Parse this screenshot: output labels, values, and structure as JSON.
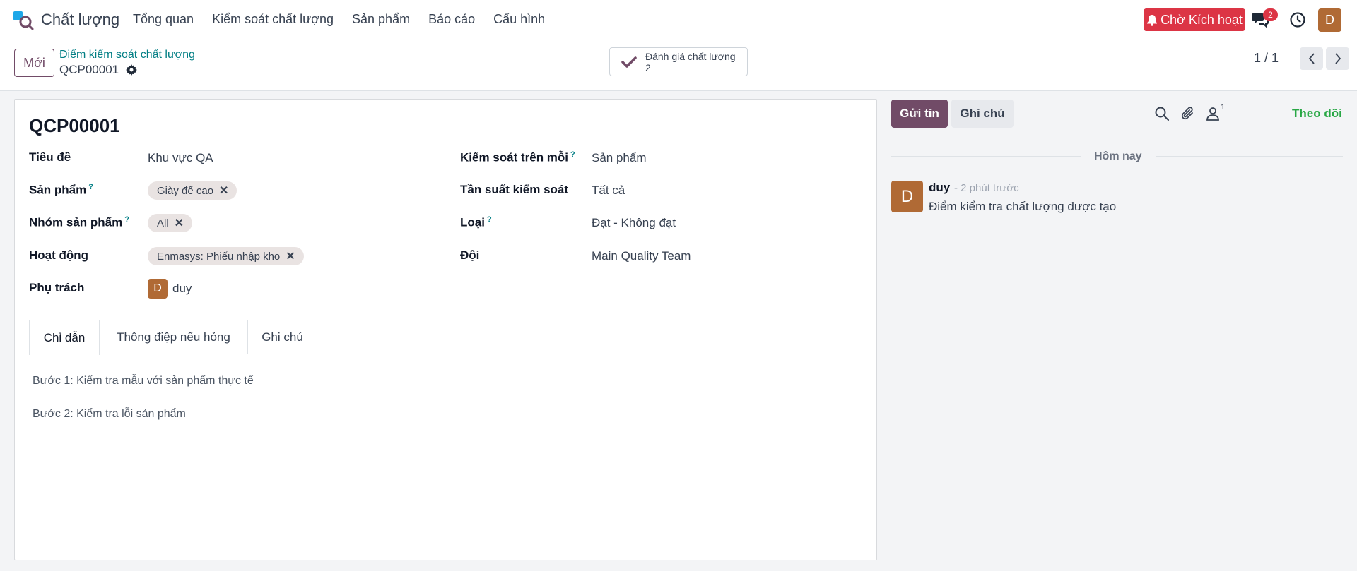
{
  "navbar": {
    "app_name": "Chất lượng",
    "menu": [
      "Tổng quan",
      "Kiểm soát chất lượng",
      "Sản phẩm",
      "Báo cáo",
      "Cấu hình"
    ],
    "activate_label": "Chờ Kích hoạt",
    "message_badge": "2",
    "avatar_letter": "D"
  },
  "control_panel": {
    "new_label": "Mới",
    "breadcrumb_parent": "Điểm kiểm soát chất lượng",
    "record_name": "QCP00001",
    "smart_button": {
      "label": "Đánh giá chất lượng",
      "count": "2"
    },
    "pager": "1 / 1"
  },
  "form": {
    "title": "QCP00001",
    "left_fields": {
      "title_label": "Tiêu đề",
      "title_value": "Khu vực QA",
      "product_label": "Sản phẩm",
      "product_tag": "Giày để cao",
      "category_label": "Nhóm sản phẩm",
      "category_tag": "All",
      "operation_label": "Hoạt động",
      "operation_tag": "Enmasys: Phiếu nhập kho",
      "responsible_label": "Phụ trách",
      "responsible_value": "duy",
      "responsible_avatar": "D"
    },
    "right_fields": {
      "control_per_label": "Kiểm soát trên mỗi",
      "control_per_value": "Sản phẩm",
      "frequency_label": "Tần suất kiểm soát",
      "frequency_value": "Tất cả",
      "type_label": "Loại",
      "type_value": "Đạt - Không đạt",
      "team_label": "Đội",
      "team_value": "Main Quality Team"
    },
    "help_mark": "?",
    "tabs": [
      "Chỉ dẫn",
      "Thông điệp nếu hỏng",
      "Ghi chú"
    ],
    "instructions": [
      "Bước 1: Kiểm tra mẫu với sản phẩm thực tế",
      "Bước 2: Kiểm tra lỗi sản phẩm"
    ]
  },
  "chatter": {
    "send_label": "Gửi tin",
    "note_label": "Ghi chú",
    "follower_count": "1",
    "follow_label": "Theo dõi",
    "today_label": "Hôm nay",
    "message": {
      "avatar": "D",
      "author": "duy",
      "time": "- 2 phút trước",
      "body": "Điểm kiểm tra chất lượng được tạo"
    }
  },
  "colors": {
    "brand": "#714b67",
    "danger": "#dc3545",
    "link": "#017e84",
    "follow": "#28a745",
    "avatar": "#b06a35"
  }
}
